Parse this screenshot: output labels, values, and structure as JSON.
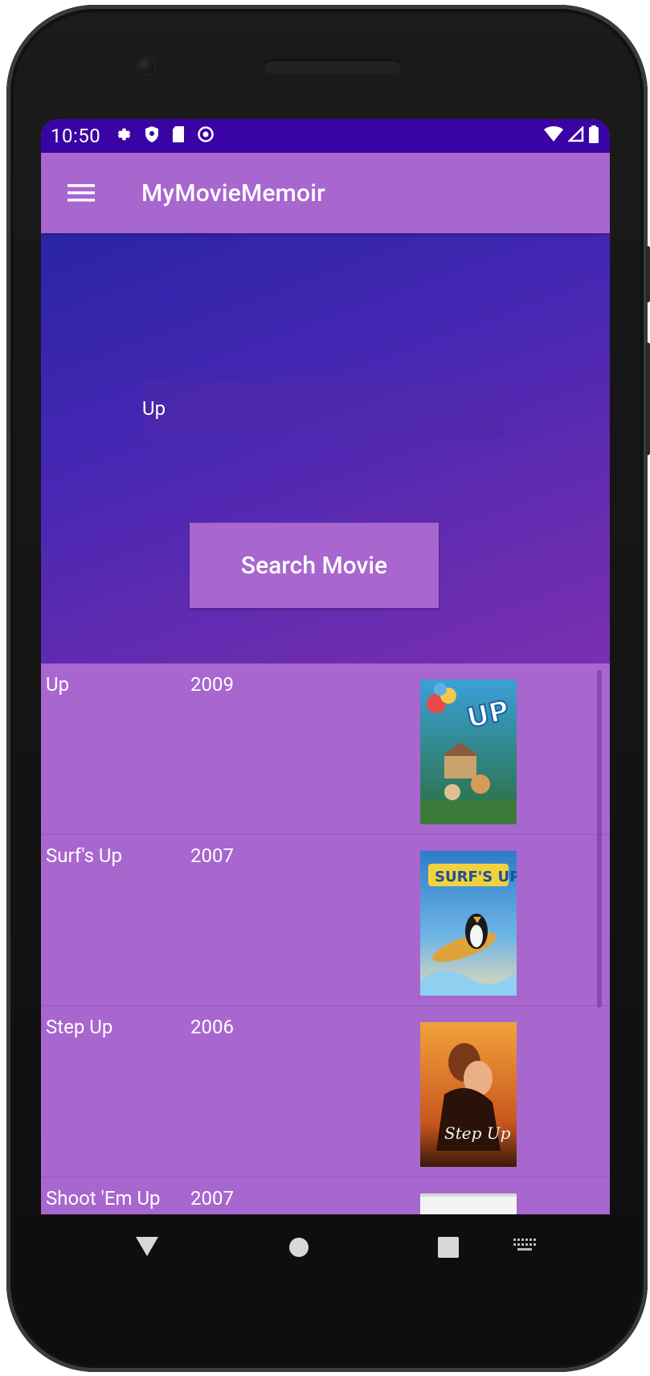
{
  "status": {
    "time": "10:50"
  },
  "appbar": {
    "title": "MyMovieMemoir"
  },
  "search": {
    "value": "Up",
    "button_label": "Search Movie"
  },
  "results": [
    {
      "title": "Up",
      "year": "2009",
      "poster": "up-poster"
    },
    {
      "title": "Surf's Up",
      "year": "2007",
      "poster": "surfs-up-poster"
    },
    {
      "title": "Step Up",
      "year": "2006",
      "poster": "step-up-poster"
    },
    {
      "title": "Shoot 'Em Up",
      "year": "2007",
      "poster": "shoot-em-up-poster"
    }
  ],
  "colors": {
    "status_bar": "#3a04a4",
    "app_bar": "#a866cf",
    "hero_gradient_start": "#2a24a6",
    "hero_gradient_end": "#7a2fb0",
    "list_background": "#a866cf"
  }
}
